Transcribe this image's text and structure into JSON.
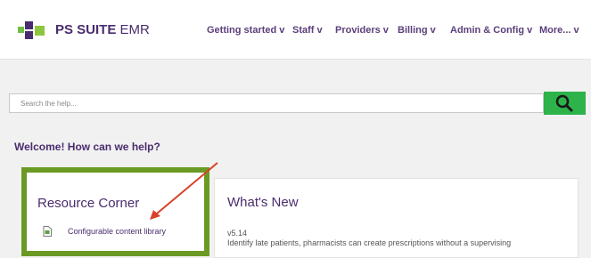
{
  "header": {
    "brand_bold": "PS SUITE",
    "brand_rest": " EMR",
    "nav": [
      {
        "label": "Getting started v"
      },
      {
        "label": "Staff v"
      },
      {
        "label": "Providers v"
      },
      {
        "label": "Billing v"
      },
      {
        "label": "Admin & Config v"
      },
      {
        "label": "More... v"
      }
    ]
  },
  "search": {
    "placeholder": "Search the help...",
    "icon": "magnifier-icon"
  },
  "welcome": "Welcome! How can we help?",
  "resource_corner": {
    "title": "Resource Corner",
    "link_label": "Configurable content library",
    "icon": "document-icon"
  },
  "whats_new": {
    "title": "What's New",
    "version": "v5.14",
    "description": "Identify late patients, pharmacists can create prescriptions without a supervising"
  },
  "colors": {
    "brand_purple": "#4a2c6e",
    "search_green": "#2db34a",
    "highlight_green": "#6a9a24",
    "arrow_red": "#d8422a"
  }
}
